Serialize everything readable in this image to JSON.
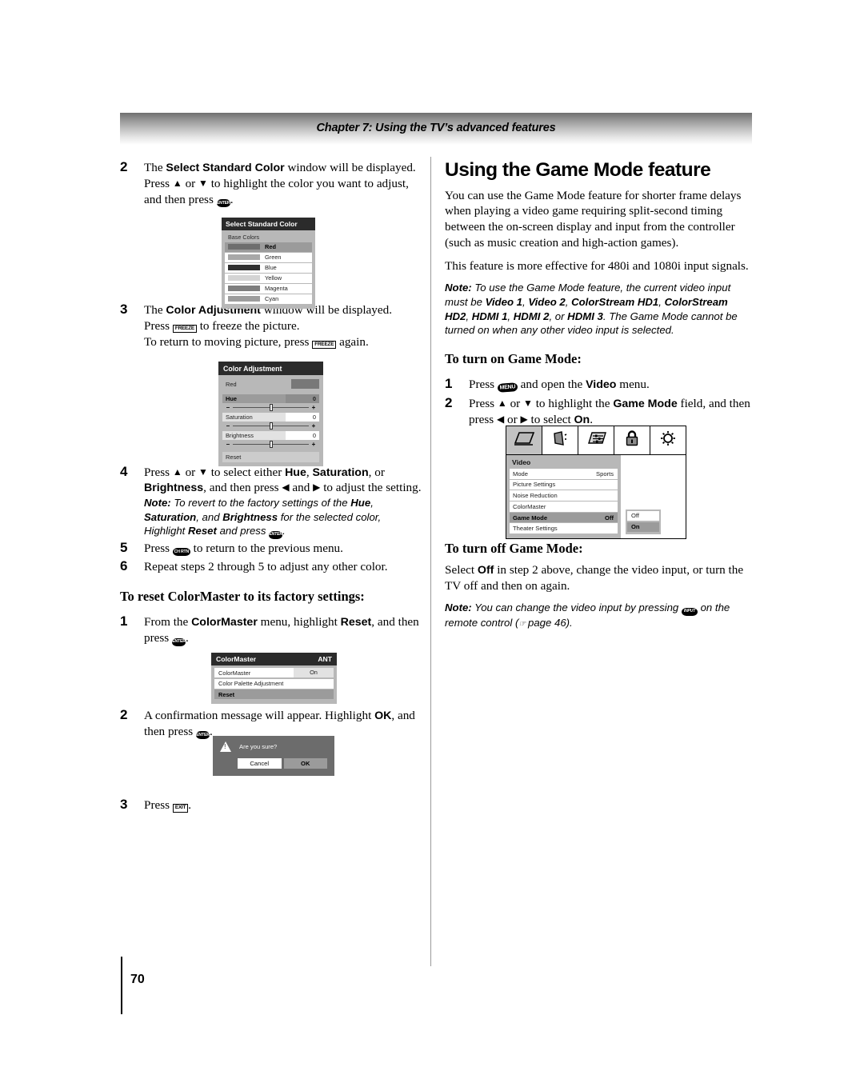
{
  "header": {
    "chapter_title": "Chapter 7: Using the TV’s advanced features"
  },
  "footer": {
    "page_number": "70"
  },
  "keys": {
    "enter": "ENTER",
    "freeze": "FREEZE",
    "chrtn": "CH RTN",
    "menu": "MENU",
    "exit": "EXIT",
    "input": "INPUT"
  },
  "left_column": {
    "step2": {
      "number": "2",
      "line1_a": "The ",
      "line1_b": "Select Standard Color",
      "line1_c": " window will be displayed.",
      "line2_a": "Press ",
      "line2_b": " or ",
      "line2_c": " to highlight the color you want to adjust, and then press ",
      "line2_d": "."
    },
    "select_standard_color": {
      "title": "Select Standard Color",
      "subtitle": "Base Colors",
      "rows": [
        {
          "label": "Red",
          "swatch": "#6e6e6e",
          "selected": true
        },
        {
          "label": "Green",
          "swatch": "#a8a8a8",
          "selected": false
        },
        {
          "label": "Blue",
          "swatch": "#303030",
          "selected": false
        },
        {
          "label": "Yellow",
          "swatch": "#d4d4d4",
          "selected": false
        },
        {
          "label": "Magenta",
          "swatch": "#7e7e7e",
          "selected": false
        },
        {
          "label": "Cyan",
          "swatch": "#9d9d9d",
          "selected": false
        }
      ]
    },
    "step3": {
      "number": "3",
      "line1_a": "The ",
      "line1_b": "Color Adjustment",
      "line1_c": " window will be displayed.",
      "line2_a": "Press ",
      "line2_b": " to freeze the picture.",
      "line3_a": "To return to moving picture, press ",
      "line3_b": " again."
    },
    "color_adjustment": {
      "title": "Color Adjustment",
      "color_name": "Red",
      "items": [
        {
          "label": "Hue",
          "value": "0",
          "selected": true
        },
        {
          "label": "Saturation",
          "value": "0",
          "selected": false
        },
        {
          "label": "Brightness",
          "value": "0",
          "selected": false
        }
      ],
      "minus": "–",
      "plus": "+",
      "reset": "Reset"
    },
    "step4": {
      "number": "4",
      "a": "Press ",
      "b": " or ",
      "c": " to select either ",
      "hue": "Hue",
      "comma1": ", ",
      "saturation": "Saturation",
      "or_text": ", or ",
      "brightness": "Brightness",
      "d": ", and then press ",
      "e": " and ",
      "f": " to adjust the setting.",
      "note_label": "Note:",
      "note_a": " To revert to the factory settings of the ",
      "note_hue": "Hue",
      "note_b": ", ",
      "note_sat": "Saturation",
      "note_c": ", and ",
      "note_bri": "Brightness",
      "note_d": " for the selected color, Highlight ",
      "note_reset": "Reset",
      "note_e": " and press ",
      "note_f": "."
    },
    "step5": {
      "number": "5",
      "a": "Press ",
      "b": " to return to the previous menu."
    },
    "step6": {
      "number": "6",
      "text": "Repeat steps 2 through 5 to adjust any other color."
    },
    "reset_heading": "To reset ColorMaster to its factory settings:",
    "reset_step1": {
      "number": "1",
      "a": "From the ",
      "b": "ColorMaster",
      "c": " menu, highlight ",
      "d": "Reset",
      "e": ", and then press ",
      "f": "."
    },
    "colormaster_menu": {
      "title": "ColorMaster",
      "title_right": "ANT",
      "items": [
        {
          "label": "ColorMaster",
          "value": "On",
          "selected": false
        },
        {
          "label": "Color Palette Adjustment",
          "value": "",
          "selected": false
        },
        {
          "label": "Reset",
          "value": "",
          "selected": true
        }
      ]
    },
    "reset_step2": {
      "number": "2",
      "a": "A confirmation message will appear. Highlight ",
      "b": "OK",
      "c": ", and then press ",
      "d": "."
    },
    "confirm_dialog": {
      "message": "Are you sure?",
      "cancel": "Cancel",
      "ok": "OK"
    },
    "reset_step3": {
      "number": "3",
      "a": "Press ",
      "b": "."
    }
  },
  "right_column": {
    "heading": "Using the Game Mode feature",
    "para1": "You can use the Game Mode feature for shorter frame delays when playing a video game requiring split-second timing between the on-screen display and input from the controller (such as music creation and high-action games).",
    "para2": "This feature is more effective for 480i and 1080i input signals.",
    "note1": {
      "label": "Note:",
      "a": " To use the Game Mode feature, the current video input must be ",
      "v1": "Video 1",
      "s1": ", ",
      "v2": "Video 2",
      "s2": ", ",
      "cs1": "ColorStream HD1",
      "s3": ", ",
      "cs2": "ColorStream HD2",
      "s4": ", ",
      "h1": "HDMI 1",
      "s5": ", ",
      "h2": "HDMI 2",
      "s6": ", or ",
      "h3": "HDMI 3",
      "b": ". The Game Mode cannot be turned on when any other video input is selected."
    },
    "turn_on_heading": "To turn on Game Mode:",
    "on_step1": {
      "number": "1",
      "a": "Press ",
      "b": " and open the ",
      "c": "Video",
      "d": " menu."
    },
    "on_step2": {
      "number": "2",
      "a": "Press ",
      "b": " or ",
      "c": " to highlight the ",
      "d": "Game Mode",
      "e": " field, and then press ",
      "f": " or ",
      "g": " to select ",
      "h": "On",
      "i": "."
    },
    "video_menu": {
      "tabs": [
        {
          "icon": "tv-screen-icon",
          "active": true
        },
        {
          "icon": "speaker-audio-icon",
          "active": false
        },
        {
          "icon": "sliders-settings-icon",
          "active": false
        },
        {
          "icon": "lock-icon",
          "active": false
        },
        {
          "icon": "sun-brightness-icon",
          "active": false
        }
      ],
      "panel_title": "Video",
      "items": [
        {
          "label": "Mode",
          "value": "Sports",
          "selected": false
        },
        {
          "label": "Picture Settings",
          "value": "",
          "selected": false
        },
        {
          "label": "Noise Reduction",
          "value": "",
          "selected": false
        },
        {
          "label": "ColorMaster",
          "value": "",
          "selected": false
        },
        {
          "label": "Game Mode",
          "value": "Off",
          "selected": true
        },
        {
          "label": "Theater Settings",
          "value": "",
          "selected": false
        }
      ],
      "popup_options": [
        {
          "label": "Off",
          "selected": false
        },
        {
          "label": "On",
          "selected": true
        }
      ]
    },
    "turn_off_heading": "To turn off Game Mode:",
    "turn_off_body_a": "Select ",
    "turn_off_body_b": "Off",
    "turn_off_body_c": " in step 2 above, change the video input, or turn the TV off and then on again.",
    "note2": {
      "label": "Note:",
      "a": " You can change the video input by pressing ",
      "b": " on the remote control (",
      "c": " page 46)."
    }
  }
}
